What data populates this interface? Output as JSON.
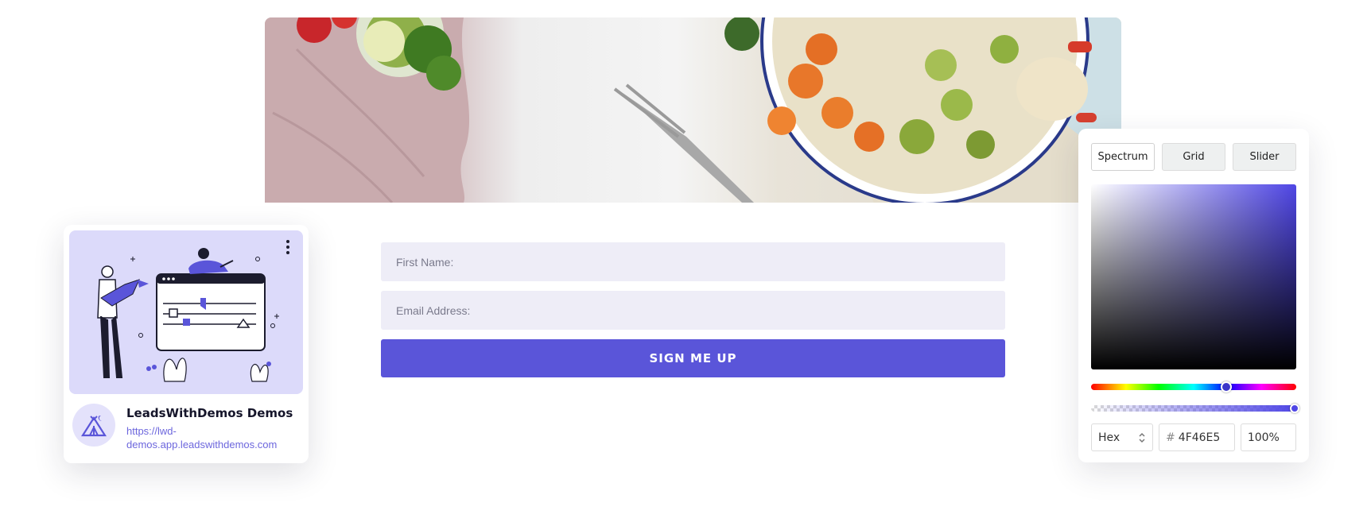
{
  "form": {
    "first_name_placeholder": "First Name:",
    "email_placeholder": "Email Address:",
    "submit_label": "SIGN ME UP",
    "submit_color": "#5a55d9",
    "field_color": "#eeedf7"
  },
  "card": {
    "title": "LeadsWithDemos Demos",
    "url_line1": "https://lwd-",
    "url_line2": "demos.app.leadswithdemos.com",
    "menu_icon": "kebab-icon",
    "avatar_icon": "tent-logo-icon",
    "accent": "#6c66dd"
  },
  "picker": {
    "tabs": [
      {
        "label": "Spectrum",
        "active": true
      },
      {
        "label": "Grid",
        "active": false
      },
      {
        "label": "Slider",
        "active": false
      }
    ],
    "mode": "Hex",
    "mode_icon": "chevron-updown-icon",
    "hex_prefix": "#",
    "hex_value": "4F46E5",
    "opacity": "100%",
    "selected_color": "#4f46e5"
  }
}
